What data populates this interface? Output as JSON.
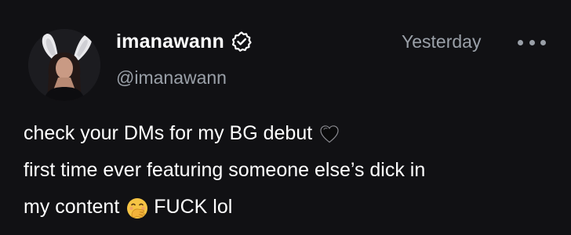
{
  "post": {
    "author": {
      "display_name": "imanawann",
      "handle": "@imanawann",
      "verified": true,
      "verified_icon": "verified-badge-icon"
    },
    "timestamp": "Yesterday",
    "more_icon": "more-horizontal-icon",
    "lines": [
      {
        "text": "check your DMs for my BG debut",
        "emoji_after": "black-heart-icon"
      },
      {
        "text": "first time ever featuring someone else’s dick in"
      },
      {
        "text_before": "my content",
        "emoji": "hand-over-mouth-face-icon",
        "text_after": "FUCK lol"
      }
    ]
  },
  "colors": {
    "background": "#111114",
    "primary_text": "#ffffff",
    "secondary_text": "#9aa0a8"
  }
}
